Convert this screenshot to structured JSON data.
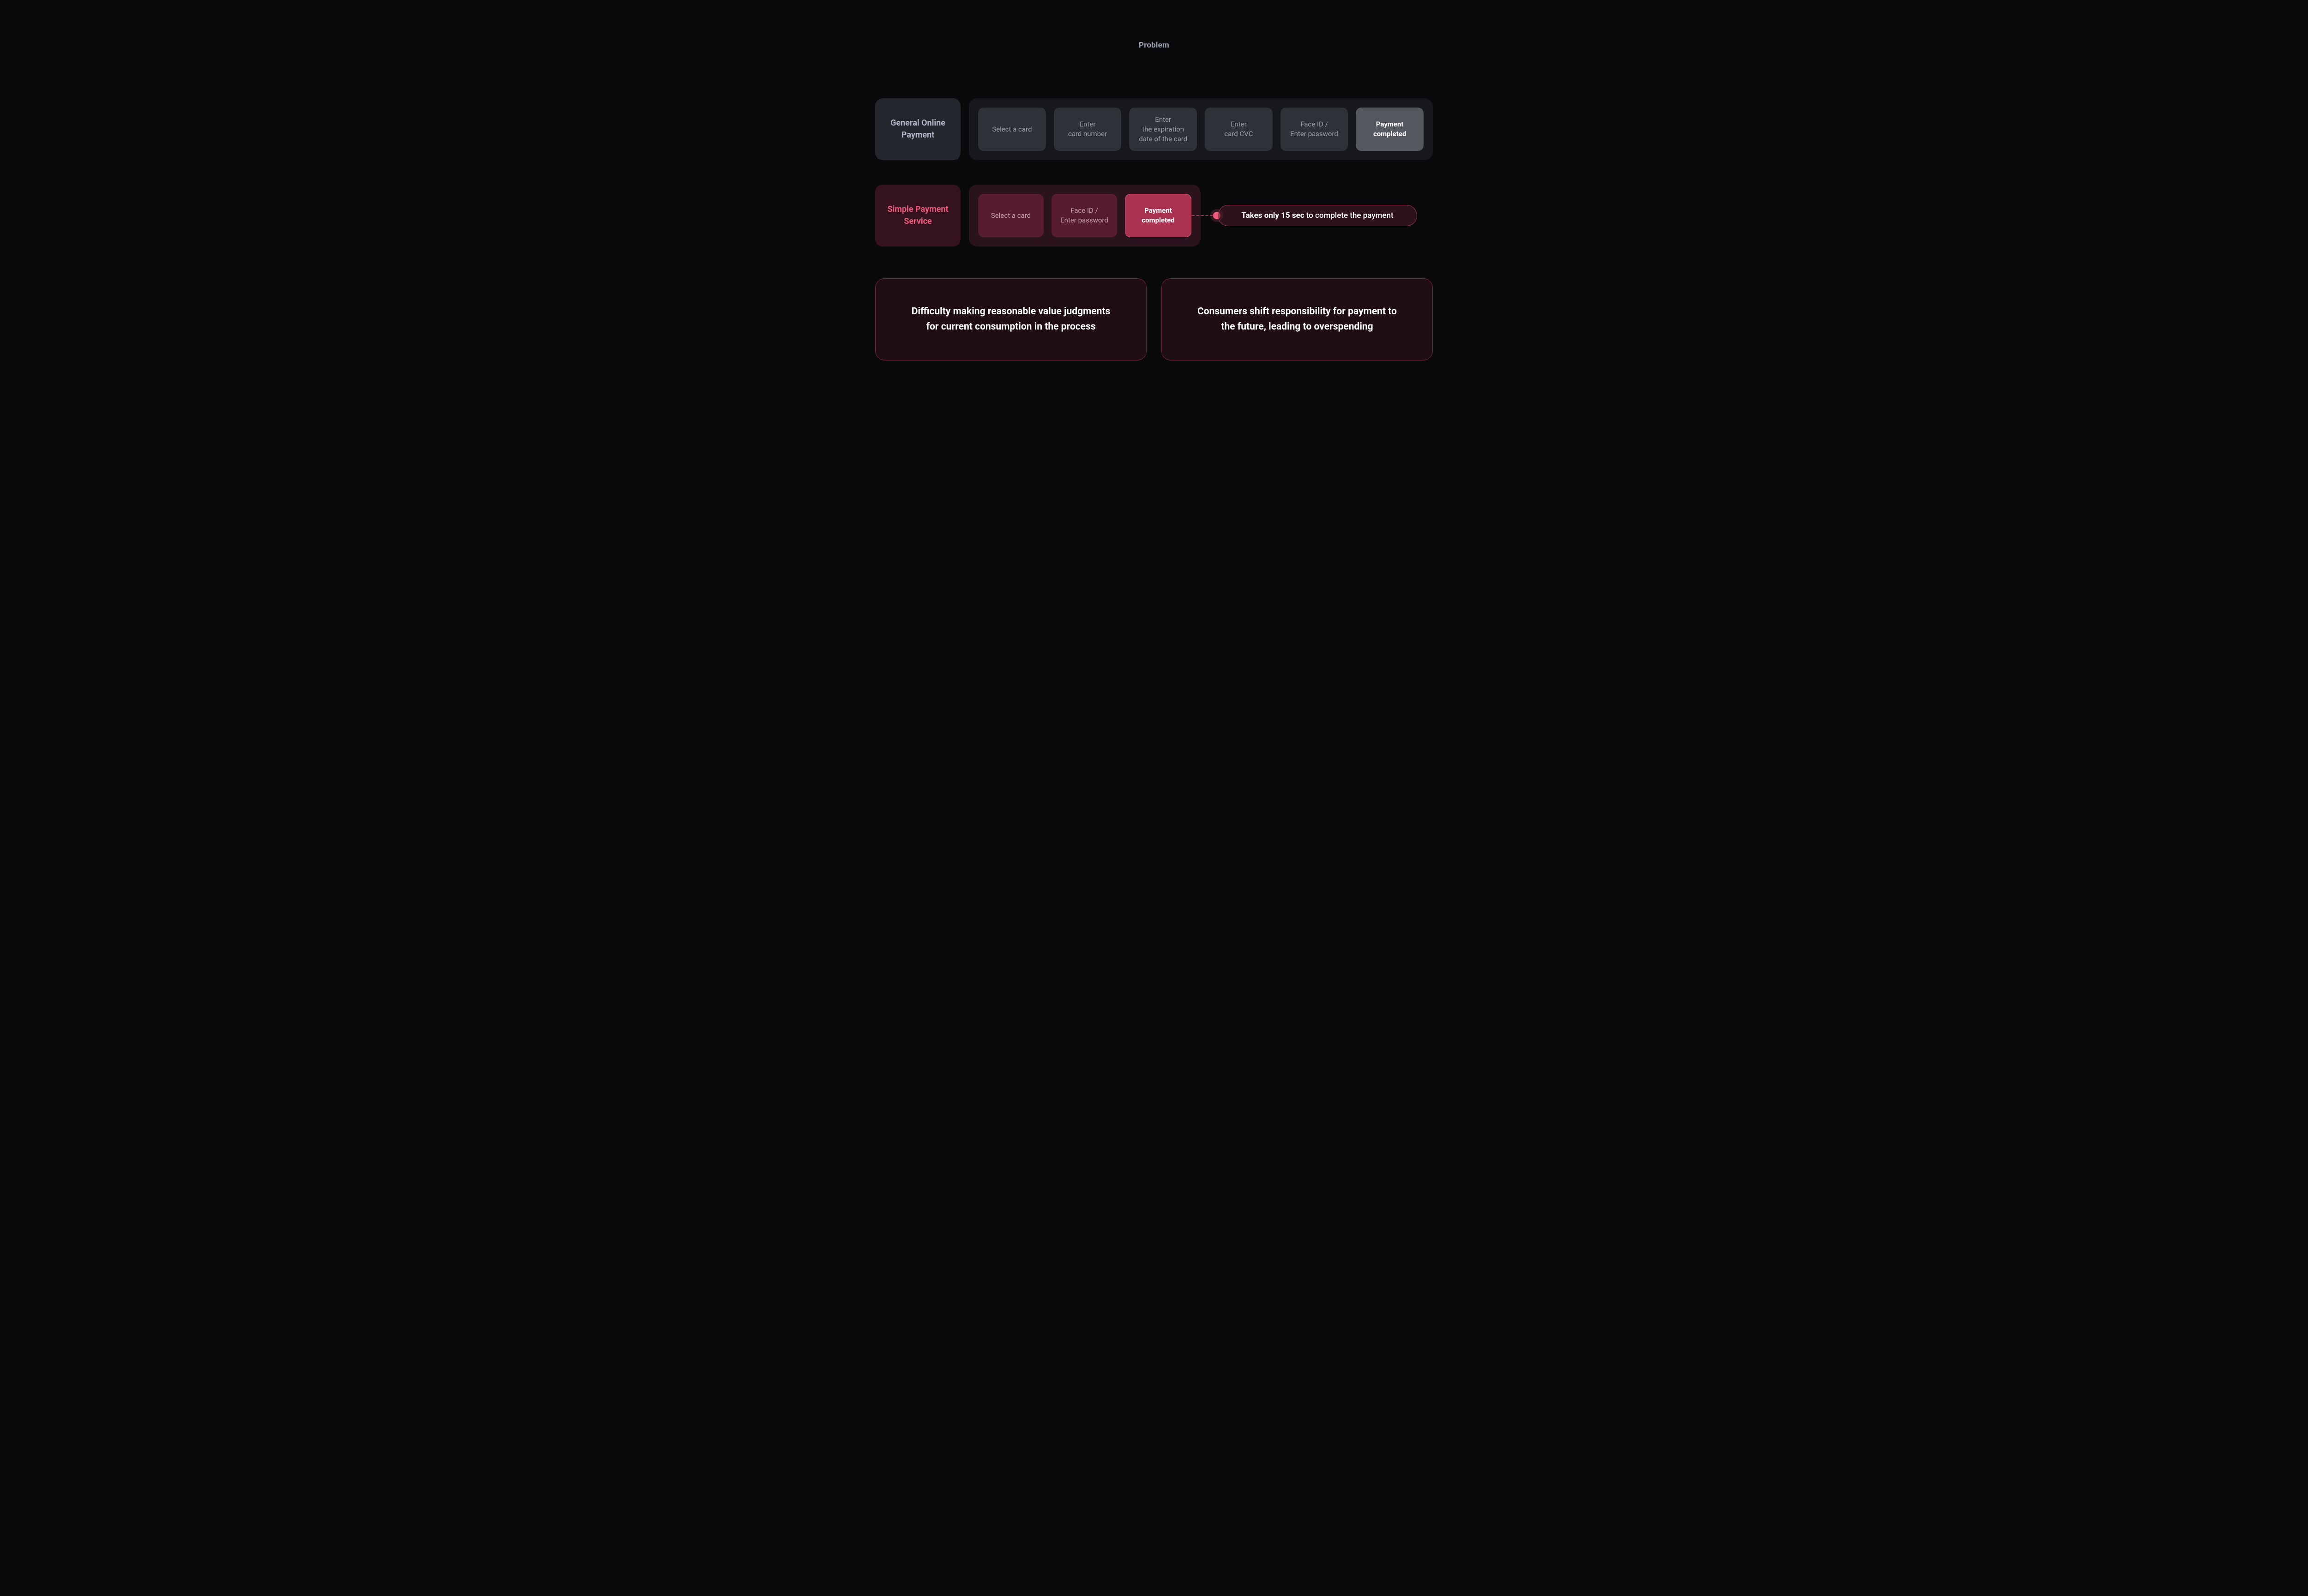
{
  "title": "Problem",
  "general": {
    "label": "General\nOnline Payment",
    "steps": [
      "Select a card",
      "Enter\ncard number",
      "Enter\nthe expiration\ndate of the card",
      "Enter\ncard CVC",
      "Face ID /\nEnter password",
      "Payment\ncompleted"
    ]
  },
  "simple": {
    "label": "Simple Payment\nService",
    "steps": [
      "Select a card",
      "Face ID /\nEnter password",
      "Payment\ncompleted"
    ],
    "callout_bold": "Takes only 15 sec",
    "callout_rest": " to complete the payment"
  },
  "problems": [
    "Difficulty making reasonable value judgments\nfor current consumption in the process",
    "Consumers shift responsibility for payment to\nthe future, leading to overspending"
  ],
  "colors": {
    "bg": "#0a0a0d",
    "accent": "#ee5a7d",
    "accent_fill": "#a83250"
  }
}
